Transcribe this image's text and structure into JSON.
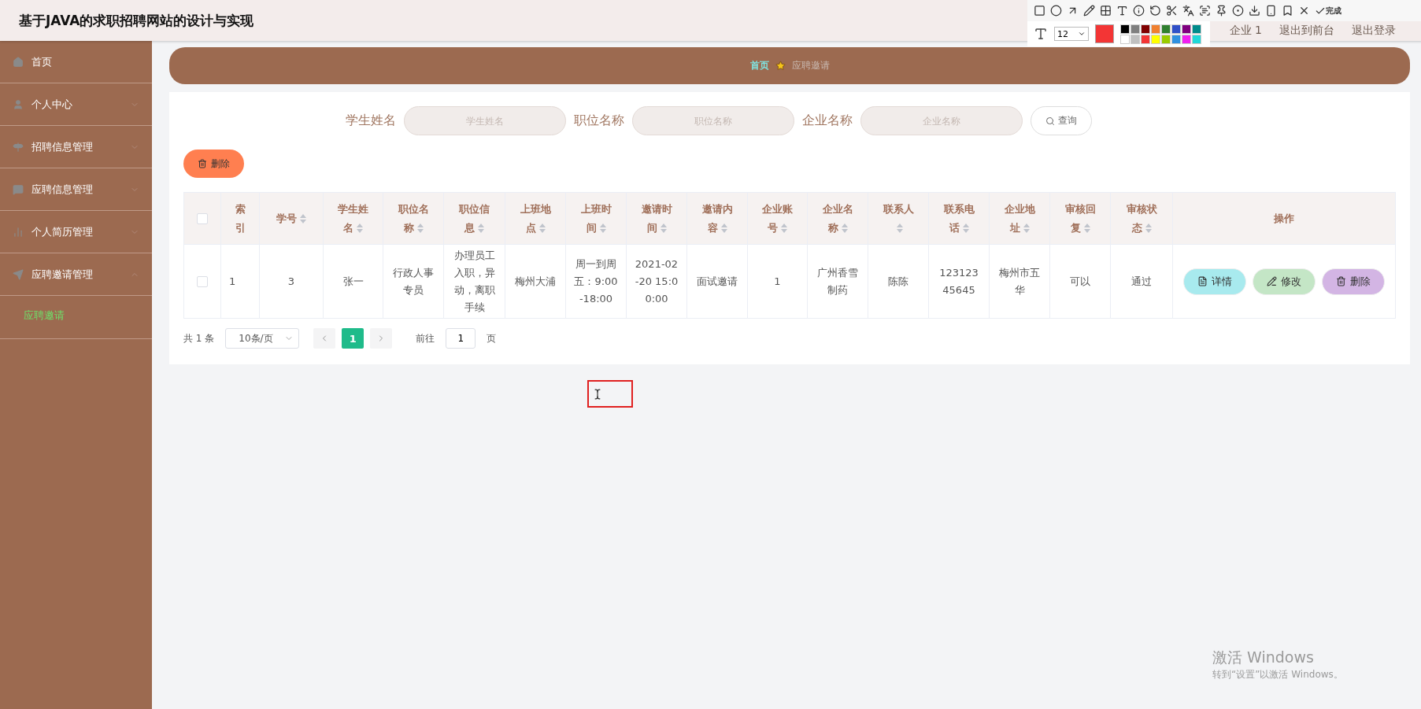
{
  "header": {
    "title": "基于JAVA的求职招聘网站的设计与实现",
    "links": [
      "企业 1",
      "退出到前台",
      "退出登录"
    ]
  },
  "screenshot_toolbar": {
    "font_size": "12",
    "done": "完成",
    "palette": [
      {
        "color": "#000000"
      },
      {
        "color": "#808080"
      },
      {
        "color": "#800000"
      },
      {
        "color": "#f08030"
      },
      {
        "color": "#308030"
      },
      {
        "color": "#3050c8"
      },
      {
        "color": "#800080"
      },
      {
        "color": "#008b8b"
      },
      {
        "color": "#ffffff"
      },
      {
        "color": "#c0c0c0"
      },
      {
        "color": "#f33535",
        "selected": true
      },
      {
        "color": "#ffff00"
      },
      {
        "color": "#99cc00"
      },
      {
        "color": "#3090e0"
      },
      {
        "color": "#f020f0"
      },
      {
        "color": "#20d8d8"
      }
    ]
  },
  "sidebar": {
    "items": [
      {
        "label": "首页",
        "expandable": false,
        "expanded": false
      },
      {
        "label": "个人中心",
        "expandable": true,
        "expanded": false
      },
      {
        "label": "招聘信息管理",
        "expandable": true,
        "expanded": false
      },
      {
        "label": "应聘信息管理",
        "expandable": true,
        "expanded": false
      },
      {
        "label": "个人简历管理",
        "expandable": true,
        "expanded": false
      },
      {
        "label": "应聘邀请管理",
        "expandable": true,
        "expanded": true,
        "children": [
          {
            "label": "应聘邀请",
            "selected": true
          }
        ]
      }
    ]
  },
  "breadcrumb": [
    "首页",
    "应聘邀请"
  ],
  "search": {
    "fields": [
      {
        "label": "学生姓名",
        "placeholder": "学生姓名"
      },
      {
        "label": "职位名称",
        "placeholder": "职位名称"
      },
      {
        "label": "企业名称",
        "placeholder": "企业名称"
      }
    ],
    "button": "查询"
  },
  "delete_button": "删除",
  "table": {
    "all_checked": false,
    "columns": [
      {
        "label": "索引",
        "sortable": false
      },
      {
        "label": "学号",
        "sortable": true
      },
      {
        "label": "学生姓名",
        "sortable": true
      },
      {
        "label": "职位名称",
        "sortable": true
      },
      {
        "label": "职位信息",
        "sortable": true
      },
      {
        "label": "上班地点",
        "sortable": true
      },
      {
        "label": "上班时间",
        "sortable": true
      },
      {
        "label": "邀请时间",
        "sortable": true
      },
      {
        "label": "邀请内容",
        "sortable": true
      },
      {
        "label": "企业账号",
        "sortable": true
      },
      {
        "label": "企业名称",
        "sortable": true
      },
      {
        "label": "联系人",
        "sortable": true
      },
      {
        "label": "联系电话",
        "sortable": true
      },
      {
        "label": "企业地址",
        "sortable": true
      },
      {
        "label": "审核回复",
        "sortable": true
      },
      {
        "label": "审核状态",
        "sortable": true
      },
      {
        "label": "操作",
        "sortable": false
      }
    ],
    "rows": [
      {
        "checked": false,
        "cells": [
          "1",
          "3",
          "张一",
          "行政人事专员",
          "办理员工入职，异动，离职手续",
          "梅州大浦",
          "周一到周五：9:00-18:00",
          "2021-02-20 15:00:00",
          "面试邀请",
          "1",
          "广州香雪制药",
          "陈陈",
          "12312345645",
          "梅州市五华",
          "可以",
          "通过"
        ],
        "actions": [
          {
            "label": "详情",
            "kind": "detail"
          },
          {
            "label": "修改",
            "kind": "edit"
          },
          {
            "label": "删除",
            "kind": "delete"
          }
        ]
      }
    ]
  },
  "pagination": {
    "total": "共 1 条",
    "page_size": "10条/页",
    "pages": [
      {
        "label": "1",
        "selected": true
      }
    ],
    "goto": "前往",
    "goto_value": "1",
    "page_unit": "页"
  },
  "activation_notice": {
    "title": "激活 Windows",
    "text": "转到“设置”以激活 Windows。"
  }
}
